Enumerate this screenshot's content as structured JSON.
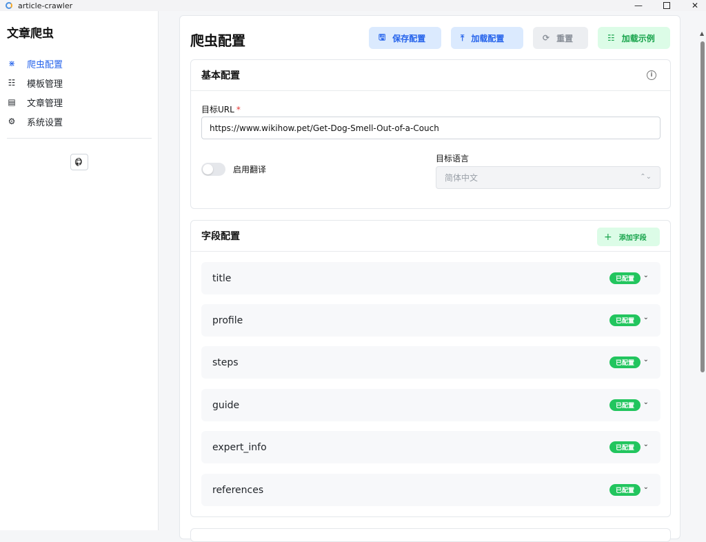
{
  "window": {
    "title": "article-crawler",
    "minimize": "—",
    "close": "✕"
  },
  "sidebar": {
    "brand": "文章爬虫",
    "items": [
      {
        "label": "爬虫配置",
        "icon": "bug-icon",
        "glyph": "⋇",
        "active": true
      },
      {
        "label": "模板管理",
        "icon": "template-icon",
        "glyph": "☷",
        "active": false
      },
      {
        "label": "文章管理",
        "icon": "document-icon",
        "glyph": "▤",
        "active": false
      },
      {
        "label": "系统设置",
        "icon": "gear-icon",
        "glyph": "⚙",
        "active": false
      }
    ],
    "github_icon": "github-icon"
  },
  "header": {
    "title": "爬虫配置",
    "buttons": {
      "save": {
        "label": "保存配置",
        "icon": "save-icon",
        "glyph": "🖫"
      },
      "load": {
        "label": "加载配置",
        "icon": "upload-icon",
        "glyph": "⤒"
      },
      "reset": {
        "label": "重置",
        "icon": "refresh-icon",
        "glyph": "⟳"
      },
      "example": {
        "label": "加载示例",
        "icon": "template-icon",
        "glyph": "☷"
      }
    }
  },
  "basic": {
    "title": "基本配置",
    "url_label": "目标URL",
    "required_mark": "*",
    "url_value": "https://www.wikihow.pet/Get-Dog-Smell-Out-of-a-Couch",
    "translate_label": "启用翻译",
    "translate_enabled": false,
    "lang_label": "目标语言",
    "lang_value": "简体中文"
  },
  "fields": {
    "title": "字段配置",
    "add_label": "添加字段",
    "badge_label": "已配置",
    "rows": [
      {
        "name": "title"
      },
      {
        "name": "profile"
      },
      {
        "name": "steps"
      },
      {
        "name": "guide"
      },
      {
        "name": "expert_info"
      },
      {
        "name": "references"
      }
    ]
  },
  "colors": {
    "accent": "#2563eb",
    "success": "#22c55e",
    "success_text": "#16a34a"
  }
}
